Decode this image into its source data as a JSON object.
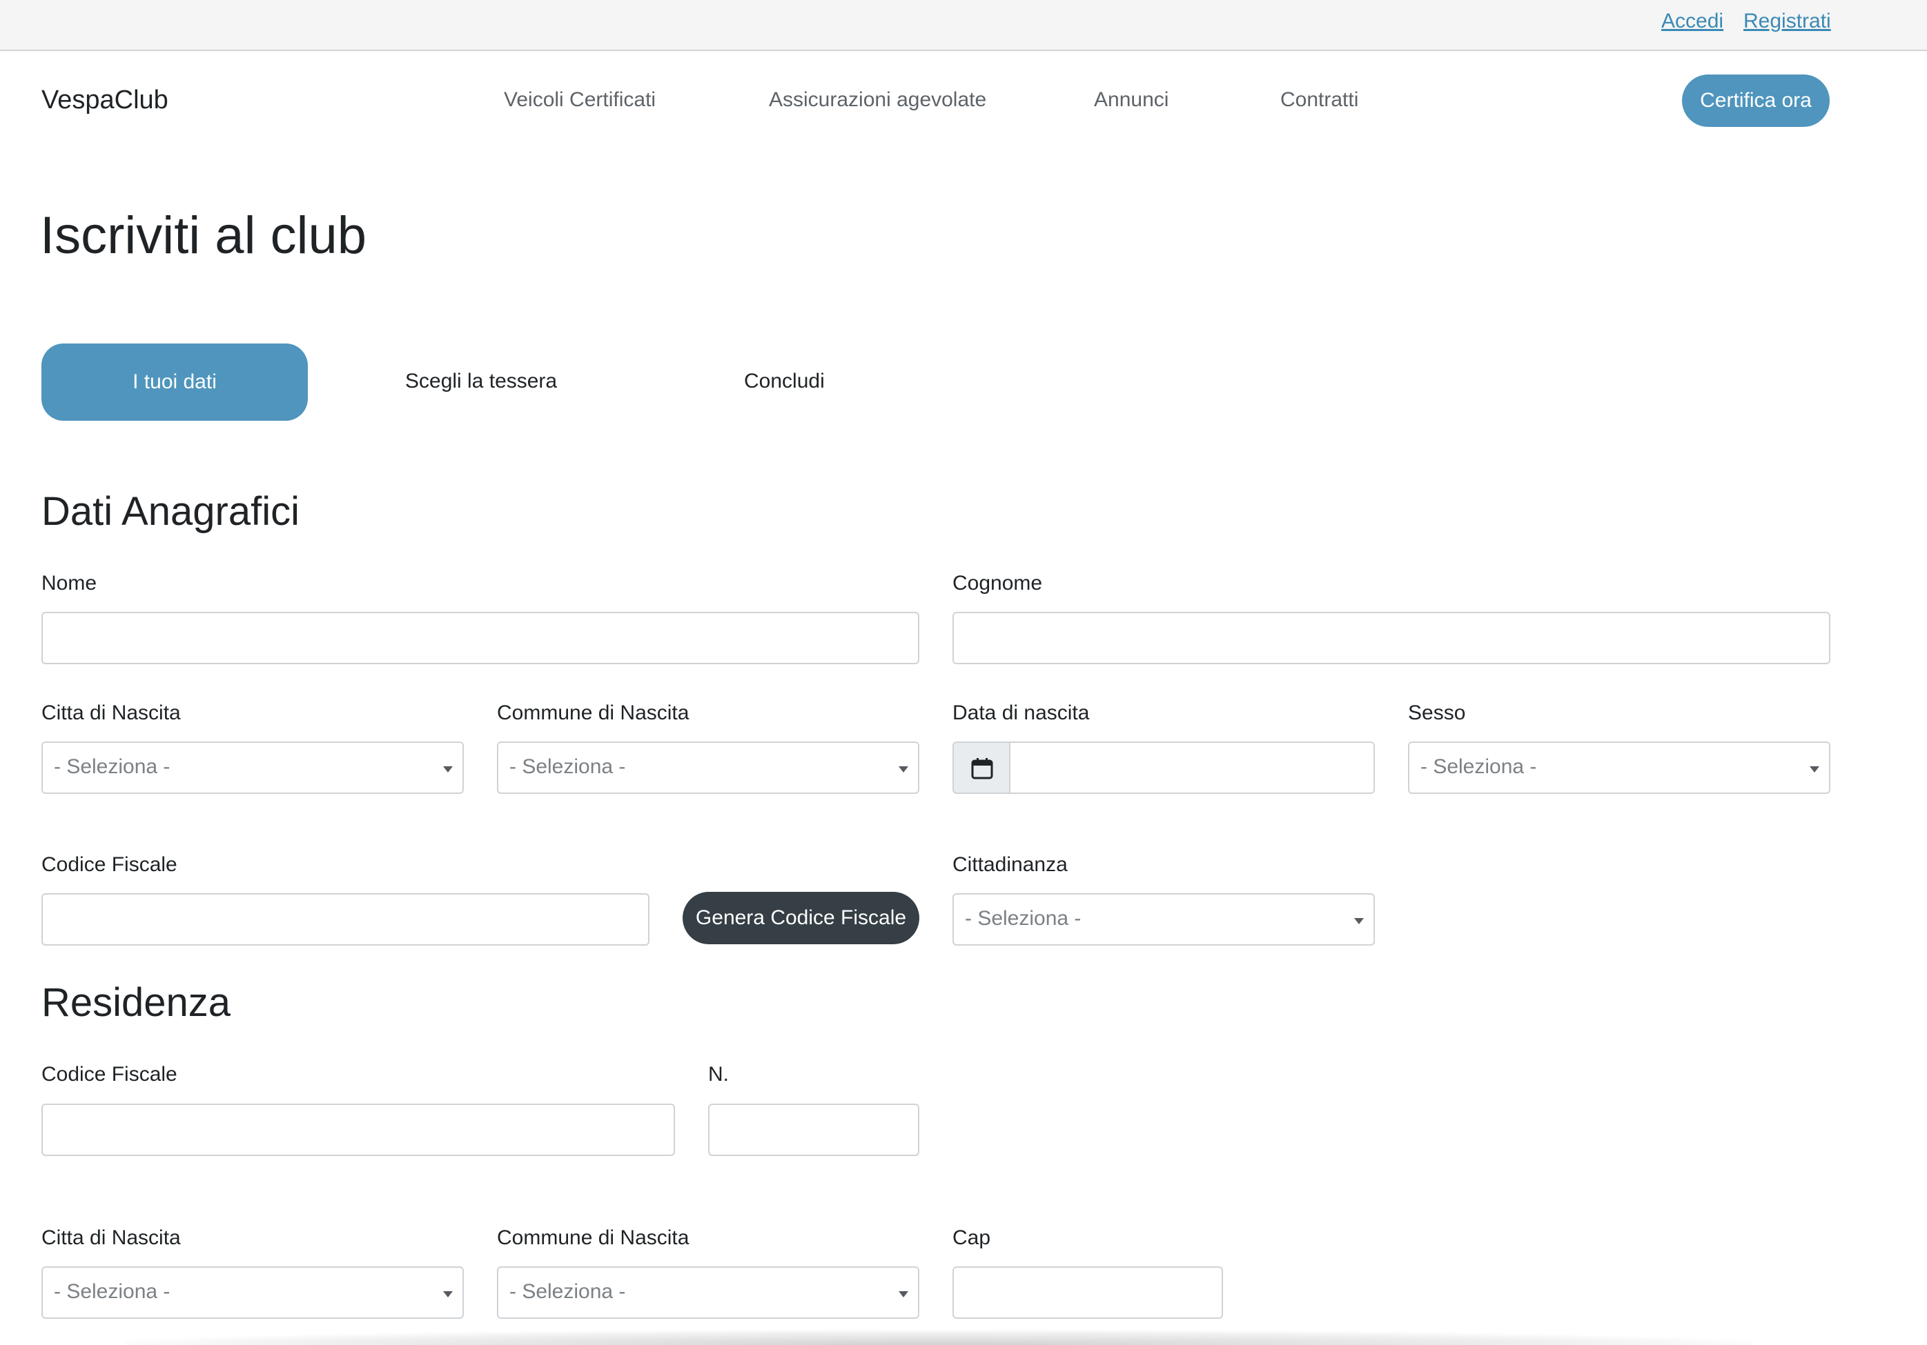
{
  "auth": {
    "login": "Accedi",
    "register": "Registrati"
  },
  "nav": {
    "brand": "VespaClub",
    "links": [
      "Veicoli Certificati",
      "Assicurazioni agevolate",
      "Annunci",
      "Contratti"
    ],
    "cta": "Certifica ora"
  },
  "page": {
    "title": "Iscriviti al club"
  },
  "steps": [
    {
      "label": "I tuoi dati",
      "active": true
    },
    {
      "label": "Scegli la tessera",
      "active": false
    },
    {
      "label": "Concludi",
      "active": false
    }
  ],
  "anagrafici": {
    "title": "Dati Anagrafici",
    "nome_label": "Nome",
    "cognome_label": "Cognome",
    "citta_label": "Citta di Nascita",
    "citta_value": "- Seleziona -",
    "comune_label": "Commune di Nascita",
    "comune_value": "- Seleziona -",
    "data_label": "Data di nascita",
    "sesso_label": "Sesso",
    "sesso_value": "- Seleziona -",
    "cf_label": "Codice Fiscale",
    "cf_button": "Genera Codice Fiscale",
    "cittadinanza_label": "Cittadinanza",
    "cittadinanza_value": "- Seleziona -"
  },
  "residenza": {
    "title": "Residenza",
    "cf_label": "Codice Fiscale",
    "n_label": "N.",
    "citta_label": "Citta di Nascita",
    "citta_value": "- Seleziona -",
    "comune_label": "Commune di Nascita",
    "comune_value": "- Seleziona -",
    "cap_label": "Cap"
  },
  "colors": {
    "accent": "#4f95bd",
    "link": "#3a8ab5",
    "dark_button": "#353f45",
    "topbar_bg": "#f5f5f5"
  },
  "icons": {
    "date_addon": "calendar-icon",
    "select_caret": "caret-down-icon"
  }
}
